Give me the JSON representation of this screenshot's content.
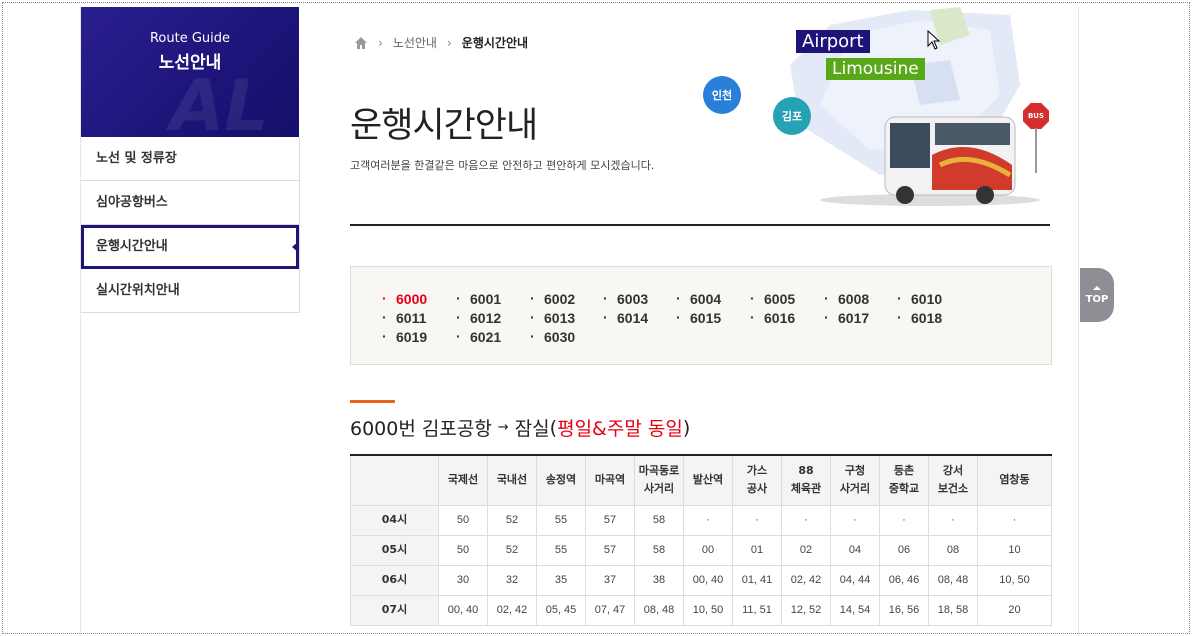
{
  "sidebar": {
    "banner_en": "Route Guide",
    "banner_ko": "노선안내",
    "items": [
      {
        "label": "노선 및 정류장"
      },
      {
        "label": "심야공항버스"
      },
      {
        "label": "운행시간안내"
      },
      {
        "label": "실시간위치안내"
      }
    ]
  },
  "breadcrumb": {
    "first": "노선안내",
    "current": "운행시간안내"
  },
  "page": {
    "title": "운행시간안내",
    "subtitle": "고객여러분을 한결같은 마음으로 안전하고 편안하게 모시겠습니다."
  },
  "hero": {
    "airport": "Airport",
    "limousine": "Limousine",
    "incheon": "인천",
    "gimpo": "김포",
    "bus_sign": "BUS"
  },
  "top_button": "TOP",
  "routes": [
    "6000",
    "6001",
    "6002",
    "6003",
    "6004",
    "6005",
    "6008",
    "6010",
    "6011",
    "6012",
    "6013",
    "6014",
    "6015",
    "6016",
    "6017",
    "6018",
    "6019",
    "6021",
    "6030"
  ],
  "active_route": "6000",
  "section": {
    "prefix": "6000번 김포공항",
    "arrow": "→",
    "dest": "잠실",
    "paren_open": "(",
    "note": "평일&주말 동일",
    "paren_close": ")"
  },
  "timetable": {
    "columns": [
      "국제선",
      "국내선",
      "송정역",
      "마곡역",
      "마곡동로 사거리",
      "발산역",
      "가스 공사",
      "88 체육관",
      "구청 사거리",
      "등촌 중학교",
      "강서 보건소",
      "염창동"
    ],
    "rows": [
      {
        "hour": "04시",
        "cells": [
          "50",
          "52",
          "55",
          "57",
          "58",
          "·",
          "·",
          "·",
          "·",
          "·",
          "·",
          "·"
        ]
      },
      {
        "hour": "05시",
        "cells": [
          "50",
          "52",
          "55",
          "57",
          "58",
          "00",
          "01",
          "02",
          "04",
          "06",
          "08",
          "10"
        ]
      },
      {
        "hour": "06시",
        "cells": [
          "30",
          "32",
          "35",
          "37",
          "38",
          "00, 40",
          "01, 41",
          "02, 42",
          "04, 44",
          "06, 46",
          "08, 48",
          "10, 50"
        ]
      },
      {
        "hour": "07시",
        "cells": [
          "00, 40",
          "02, 42",
          "05, 45",
          "07, 47",
          "08, 48",
          "10, 50",
          "11, 51",
          "12, 52",
          "14, 54",
          "16, 56",
          "18, 58",
          "20"
        ]
      }
    ]
  }
}
